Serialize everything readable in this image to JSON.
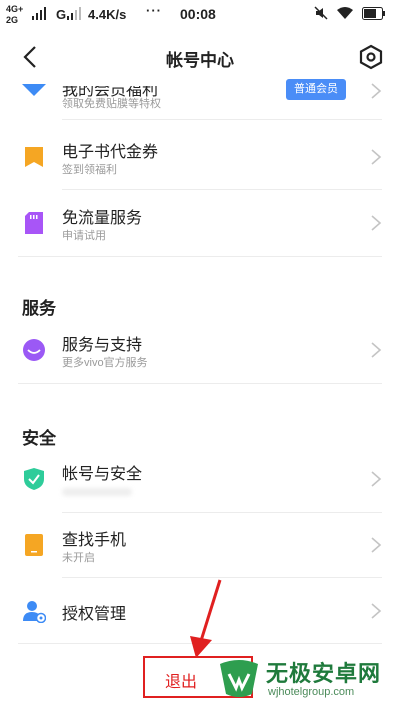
{
  "status_bar": {
    "network_top": "4G+",
    "network_bottom": "2G",
    "g_label": "G",
    "speed": "4.4K/s",
    "dots": "···",
    "time": "00:08",
    "icons": [
      "mute-icon",
      "wifi-icon",
      "battery-icon"
    ]
  },
  "header": {
    "title": "帐号中心",
    "back_icon": "chevron-left-icon",
    "settings_icon": "hexagon-settings-icon"
  },
  "items": {
    "welfare": {
      "main": "我的会员福利",
      "sub": "领取免费贴膜等特权",
      "badge": "普通会员",
      "icon_color": "#3d8bf5"
    },
    "ebook": {
      "main": "电子书代金券",
      "sub": "签到领福利",
      "icon_color": "#f5a623"
    },
    "traffic": {
      "main": "免流量服务",
      "sub": "申请试用",
      "icon_color": "#a855f7"
    },
    "support": {
      "main": "服务与支持",
      "sub": "更多vivo官方服务",
      "icon_color": "#9b59f5"
    },
    "security": {
      "main": "帐号与安全",
      "icon_color": "#2ecc9a"
    },
    "find_phone": {
      "main": "查找手机",
      "sub": "未开启",
      "icon_color": "#f5a623"
    },
    "authorization": {
      "main": "授权管理",
      "icon_color": "#3d8bf5"
    }
  },
  "sections": {
    "service": "服务",
    "security": "安全"
  },
  "logout": {
    "label": "退出"
  },
  "watermark": {
    "title": "无极安卓网",
    "url": "wjhotelgroup.com"
  },
  "accent_colors": {
    "highlight": "#e02020",
    "badge": "#4a8df7"
  }
}
